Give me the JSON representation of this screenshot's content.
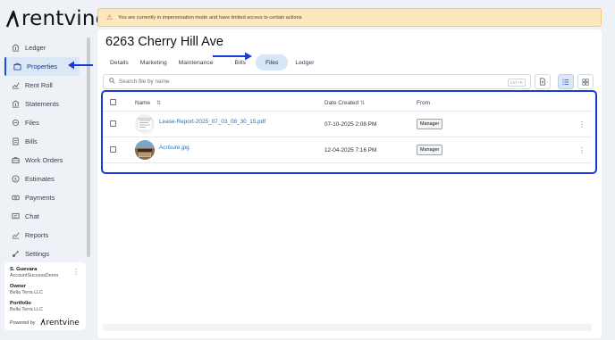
{
  "brand": {
    "name": "rentvine"
  },
  "sidebar": {
    "items": [
      {
        "label": "Ledger",
        "icon": "bank-icon",
        "active": false
      },
      {
        "label": "Properties",
        "icon": "building-icon",
        "active": true
      },
      {
        "label": "Rent Roll",
        "icon": "chart-icon",
        "active": false
      },
      {
        "label": "Statements",
        "icon": "bank-icon",
        "active": false
      },
      {
        "label": "Files",
        "icon": "files-icon",
        "active": false
      },
      {
        "label": "Bills",
        "icon": "receipt-icon",
        "active": false
      },
      {
        "label": "Work Orders",
        "icon": "toolbox-icon",
        "active": false
      },
      {
        "label": "Estimates",
        "icon": "dollar-icon",
        "active": false
      },
      {
        "label": "Payments",
        "icon": "payments-icon",
        "active": false
      },
      {
        "label": "Chat",
        "icon": "chat-icon",
        "active": false
      },
      {
        "label": "Reports",
        "icon": "reports-icon",
        "active": false
      },
      {
        "label": "Settings",
        "icon": "settings-icon",
        "active": false
      }
    ]
  },
  "user": {
    "name": "S. Guevara",
    "account": "AccountSuccessDemo",
    "owner_label": "Owner",
    "owner": "Bella Terra LLC",
    "portfolio_label": "Portfolio",
    "portfolio": "Bella Terra LLC",
    "powered_by": "Powered by"
  },
  "banner": {
    "text": "You are currently in impersonation mode and have limited access to certain actions"
  },
  "property": {
    "title": "6263 Cherry Hill Ave"
  },
  "tabs": [
    "Details",
    "Marketing",
    "Maintenance",
    "Bills",
    "Files",
    "Ledger"
  ],
  "active_tab": "Files",
  "search": {
    "placeholder": "Search file by name",
    "shortcut": "Ctrl +K"
  },
  "table": {
    "headers": {
      "name": "Name",
      "date": "Date Created",
      "from": "From"
    },
    "rows": [
      {
        "name": "Lease-Report-2025_07_03_08_30_15.pdf",
        "date": "07-10-2025 2:08 PM",
        "from": "Manager"
      },
      {
        "name": "Acrisure.jpg",
        "date": "12-04-2025 7:16 PM",
        "from": "Manager"
      }
    ]
  },
  "colors": {
    "accent": "#1d4ed8",
    "annotation": "#1a3bd6",
    "banner_bg": "#fde7bd",
    "active_bg": "#d7e6f7"
  }
}
